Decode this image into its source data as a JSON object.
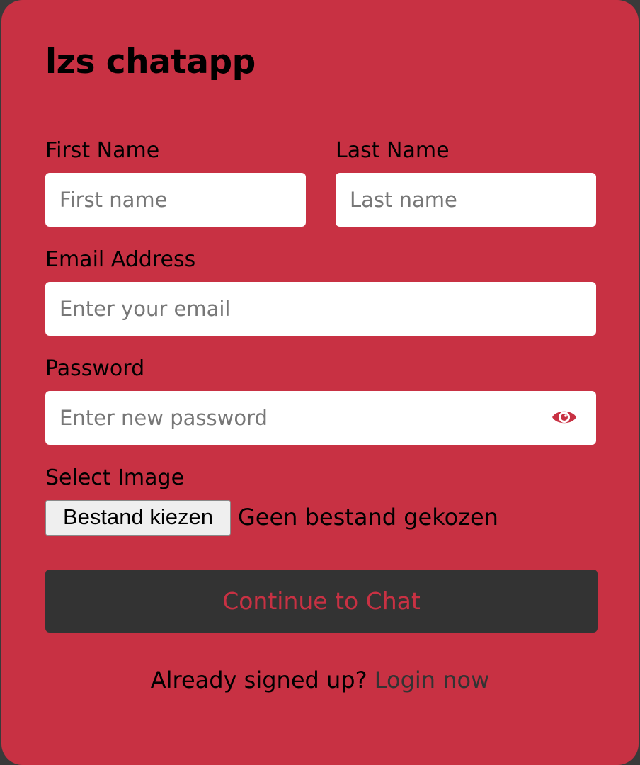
{
  "app": {
    "title": "lzs chatapp"
  },
  "form": {
    "first_name": {
      "label": "First Name",
      "placeholder": "First name",
      "value": ""
    },
    "last_name": {
      "label": "Last Name",
      "placeholder": "Last name",
      "value": ""
    },
    "email": {
      "label": "Email Address",
      "placeholder": "Enter your email",
      "value": ""
    },
    "password": {
      "label": "Password",
      "placeholder": "Enter new password",
      "value": "",
      "toggle_icon": "eye-icon"
    },
    "image": {
      "label": "Select Image",
      "button_label": "Bestand kiezen",
      "status": "Geen bestand gekozen"
    },
    "submit_label": "Continue to Chat"
  },
  "footer": {
    "prompt": "Already signed up?",
    "link_label": "Login now"
  },
  "colors": {
    "accent": "#c83143",
    "button_bg": "#333333",
    "background": "#3a3a3a"
  }
}
